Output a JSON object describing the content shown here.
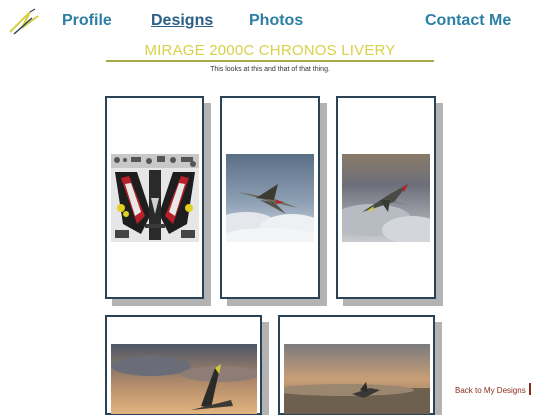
{
  "nav": {
    "profile": "Profile",
    "designs": "Designs",
    "photos": "Photos",
    "contact": "Contact Me"
  },
  "page": {
    "title": "MIRAGE 2000C CHRONOS LIVERY",
    "subtitle": "This looks at this and that of that thing."
  },
  "gallery": {
    "items": [
      {
        "kind": "livery-texture-sheet"
      },
      {
        "kind": "jet-over-clouds"
      },
      {
        "kind": "jet-over-clouds-sunset"
      },
      {
        "kind": "jet-sunset-landscape"
      },
      {
        "kind": "jet-sunset-landscape"
      }
    ]
  },
  "footer": {
    "back_label": "Back to My Designs"
  },
  "colors": {
    "nav": "#2e7fa6",
    "nav_active": "#2b5f86",
    "title": "#d8d048",
    "card_border": "#2a4356",
    "back_link": "#8b2c1a"
  }
}
